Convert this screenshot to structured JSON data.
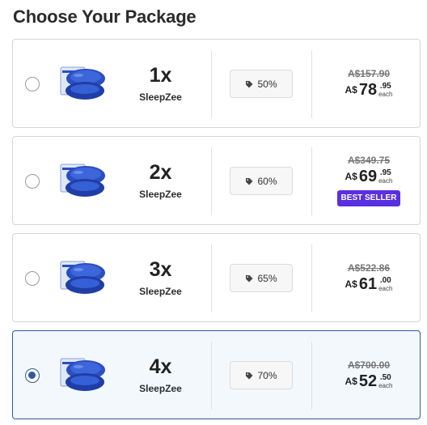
{
  "page": {
    "title": "Choose Your Package"
  },
  "packages": [
    {
      "quantity": "1x",
      "product": "SleepZee",
      "discount": "50%",
      "old_price": "A$157.90",
      "currency": "A$",
      "price_whole": "78",
      "price_cents": ".95",
      "price_unit": "each",
      "badge": "",
      "selected": false
    },
    {
      "quantity": "2x",
      "product": "SleepZee",
      "discount": "60%",
      "old_price": "A$349.75",
      "currency": "A$",
      "price_whole": "69",
      "price_cents": ".95",
      "price_unit": "each",
      "badge": "BEST SELLER",
      "selected": false
    },
    {
      "quantity": "3x",
      "product": "SleepZee",
      "discount": "65%",
      "old_price": "A$522.86",
      "currency": "A$",
      "price_whole": "61",
      "price_cents": ".00",
      "price_unit": "each",
      "badge": "",
      "selected": false
    },
    {
      "quantity": "4x",
      "product": "SleepZee",
      "discount": "70%",
      "old_price": "A$700.00",
      "currency": "A$",
      "price_whole": "52",
      "price_cents": ".50",
      "price_unit": "each",
      "badge": "",
      "selected": true
    }
  ],
  "icons": {
    "discount": "price-tag-icon",
    "product": "product-box-icon"
  },
  "colors": {
    "selected_border": "#2c5aa0",
    "selected_bg": "#f3f8fd",
    "best_seller_bg": "#5a2fe0",
    "product_blue": "#2a4fc0"
  }
}
